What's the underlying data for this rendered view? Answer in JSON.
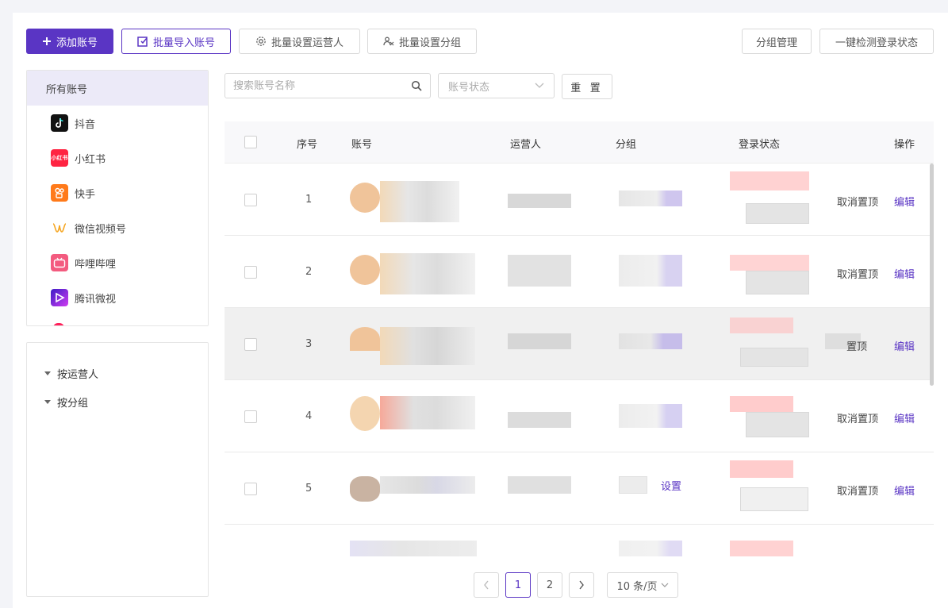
{
  "toolbar": {
    "add_account": "添加账号",
    "batch_import": "批量导入账号",
    "batch_operator": "批量设置运营人",
    "batch_group": "批量设置分组",
    "group_manage": "分组管理",
    "check_login": "一键检测登录状态"
  },
  "sidebar": {
    "all_accounts": "所有账号",
    "platforms": [
      {
        "label": "抖音",
        "icon": "douyin-icon",
        "color": "#111111"
      },
      {
        "label": "小红书",
        "icon": "xiaohongshu-icon",
        "color": "#ff2442",
        "mark": "小红书"
      },
      {
        "label": "快手",
        "icon": "kuaishou-icon",
        "color": "#ff7a1a"
      },
      {
        "label": "微信视频号",
        "icon": "wechat-channels-icon",
        "color": "#f5a623"
      },
      {
        "label": "哔哩哔哩",
        "icon": "bilibili-icon",
        "color": "#f35b7f"
      },
      {
        "label": "腾讯微视",
        "icon": "weishi-icon",
        "color": "#5b2fd6"
      }
    ],
    "tree": [
      {
        "label": "按运营人"
      },
      {
        "label": "按分组"
      }
    ]
  },
  "filters": {
    "search_placeholder": "搜索账号名称",
    "status_placeholder": "账号状态",
    "reset_label": "重 置"
  },
  "table": {
    "headers": {
      "index": "序号",
      "account": "账号",
      "operator": "运营人",
      "group": "分组",
      "login_status": "登录状态",
      "actions": "操作"
    },
    "rows": [
      {
        "index": "1",
        "action_a": "取消置顶",
        "action_b": "编辑"
      },
      {
        "index": "2",
        "action_a": "取消置顶",
        "action_b": "编辑"
      },
      {
        "index": "3",
        "action_a": "置顶",
        "action_b": "编辑"
      },
      {
        "index": "4",
        "action_a": "取消置顶",
        "action_b": "编辑"
      },
      {
        "index": "5",
        "action_a": "取消置顶",
        "action_b": "编辑",
        "group_link": "设置"
      }
    ]
  },
  "pagination": {
    "pages": [
      "1",
      "2"
    ],
    "current": "1",
    "page_size": "10 条/页"
  },
  "colors": {
    "accent": "#5a35c4"
  }
}
